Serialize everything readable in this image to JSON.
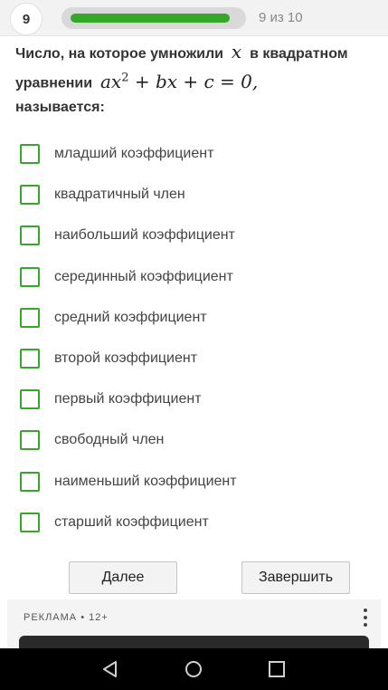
{
  "header": {
    "question_number": "9",
    "progress_text": "9 из 10",
    "progress_value": 0.9,
    "accent_color": "#35a82a"
  },
  "question": {
    "text_before_math": "Число, на которое умножили",
    "variable": "x",
    "text_middle": "в квадратном уравнении",
    "equation_parts": {
      "a": "ax",
      "exp": "2",
      "rest": "+ bx + c = 0",
      "comma": ","
    },
    "text_after": "называется:"
  },
  "answers": [
    {
      "label": "младший коэффициент",
      "checked": false
    },
    {
      "label": "квадратичный член",
      "checked": false
    },
    {
      "label": "наибольший коэффициент",
      "checked": false
    },
    {
      "label": "серединный коэффициент",
      "checked": false
    },
    {
      "label": "средний коэффициент",
      "checked": false
    },
    {
      "label": "второй коэффициент",
      "checked": false
    },
    {
      "label": "первый коэффициент",
      "checked": false
    },
    {
      "label": "свободный член",
      "checked": false
    },
    {
      "label": "наименьший коэффициент",
      "checked": false
    },
    {
      "label": "старший коэффициент",
      "checked": false
    }
  ],
  "buttons": {
    "next_label": "Далее",
    "finish_label": "Завершить"
  },
  "ad": {
    "label": "РЕКЛАМА • 12+"
  },
  "navbar": {
    "icons": [
      "back-icon",
      "home-icon",
      "recents-icon"
    ]
  }
}
